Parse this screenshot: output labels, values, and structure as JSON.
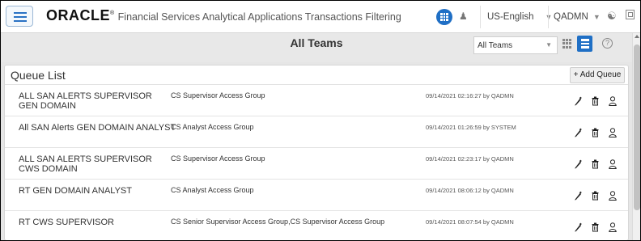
{
  "header": {
    "brand_logo": "ORACLE",
    "brand_mark": "®",
    "brand_subtitle": "Financial Services Analytical Applications Transactions Filtering",
    "language": "US-English",
    "user": "QADMN",
    "accent_color": "#1f6fc5",
    "icons": [
      "menu-icon",
      "apps-icon",
      "user-glyph-icon",
      "caret-down-icon",
      "accessibility-icon",
      "window-icon"
    ]
  },
  "titlebar": {
    "title": "All Teams",
    "team_filter": "All Teams",
    "help_glyph": "?"
  },
  "queue_list": {
    "title": "Queue List",
    "add_button": "+ Add Queue",
    "rows": [
      {
        "name": "ALL SAN ALERTS SUPERVISOR GEN DOMAIN",
        "group": "CS Supervisor Access Group",
        "meta": "09/14/2021 02:16:27 by QADMN"
      },
      {
        "name": "All SAN Alerts GEN DOMAIN ANALYST",
        "group": "CS Analyst Access Group",
        "meta": "09/14/2021 01:26:59 by SYSTEM"
      },
      {
        "name": "ALL SAN ALERTS SUPERVISOR CWS DOMAIN",
        "group": "CS Supervisor Access Group",
        "meta": "09/14/2021 02:23:17 by QADMN"
      },
      {
        "name": "RT GEN DOMAIN ANALYST",
        "group": "CS Analyst Access Group",
        "meta": "09/14/2021 08:06:12 by QADMN"
      },
      {
        "name": "RT CWS SUPERVISOR",
        "group": "CS Senior Supervisor Access Group,CS Supervisor Access Group",
        "meta": "09/14/2021 08:07:54 by QADMN"
      }
    ],
    "row_actions": [
      "edit-icon",
      "delete-icon",
      "user-icon"
    ]
  }
}
